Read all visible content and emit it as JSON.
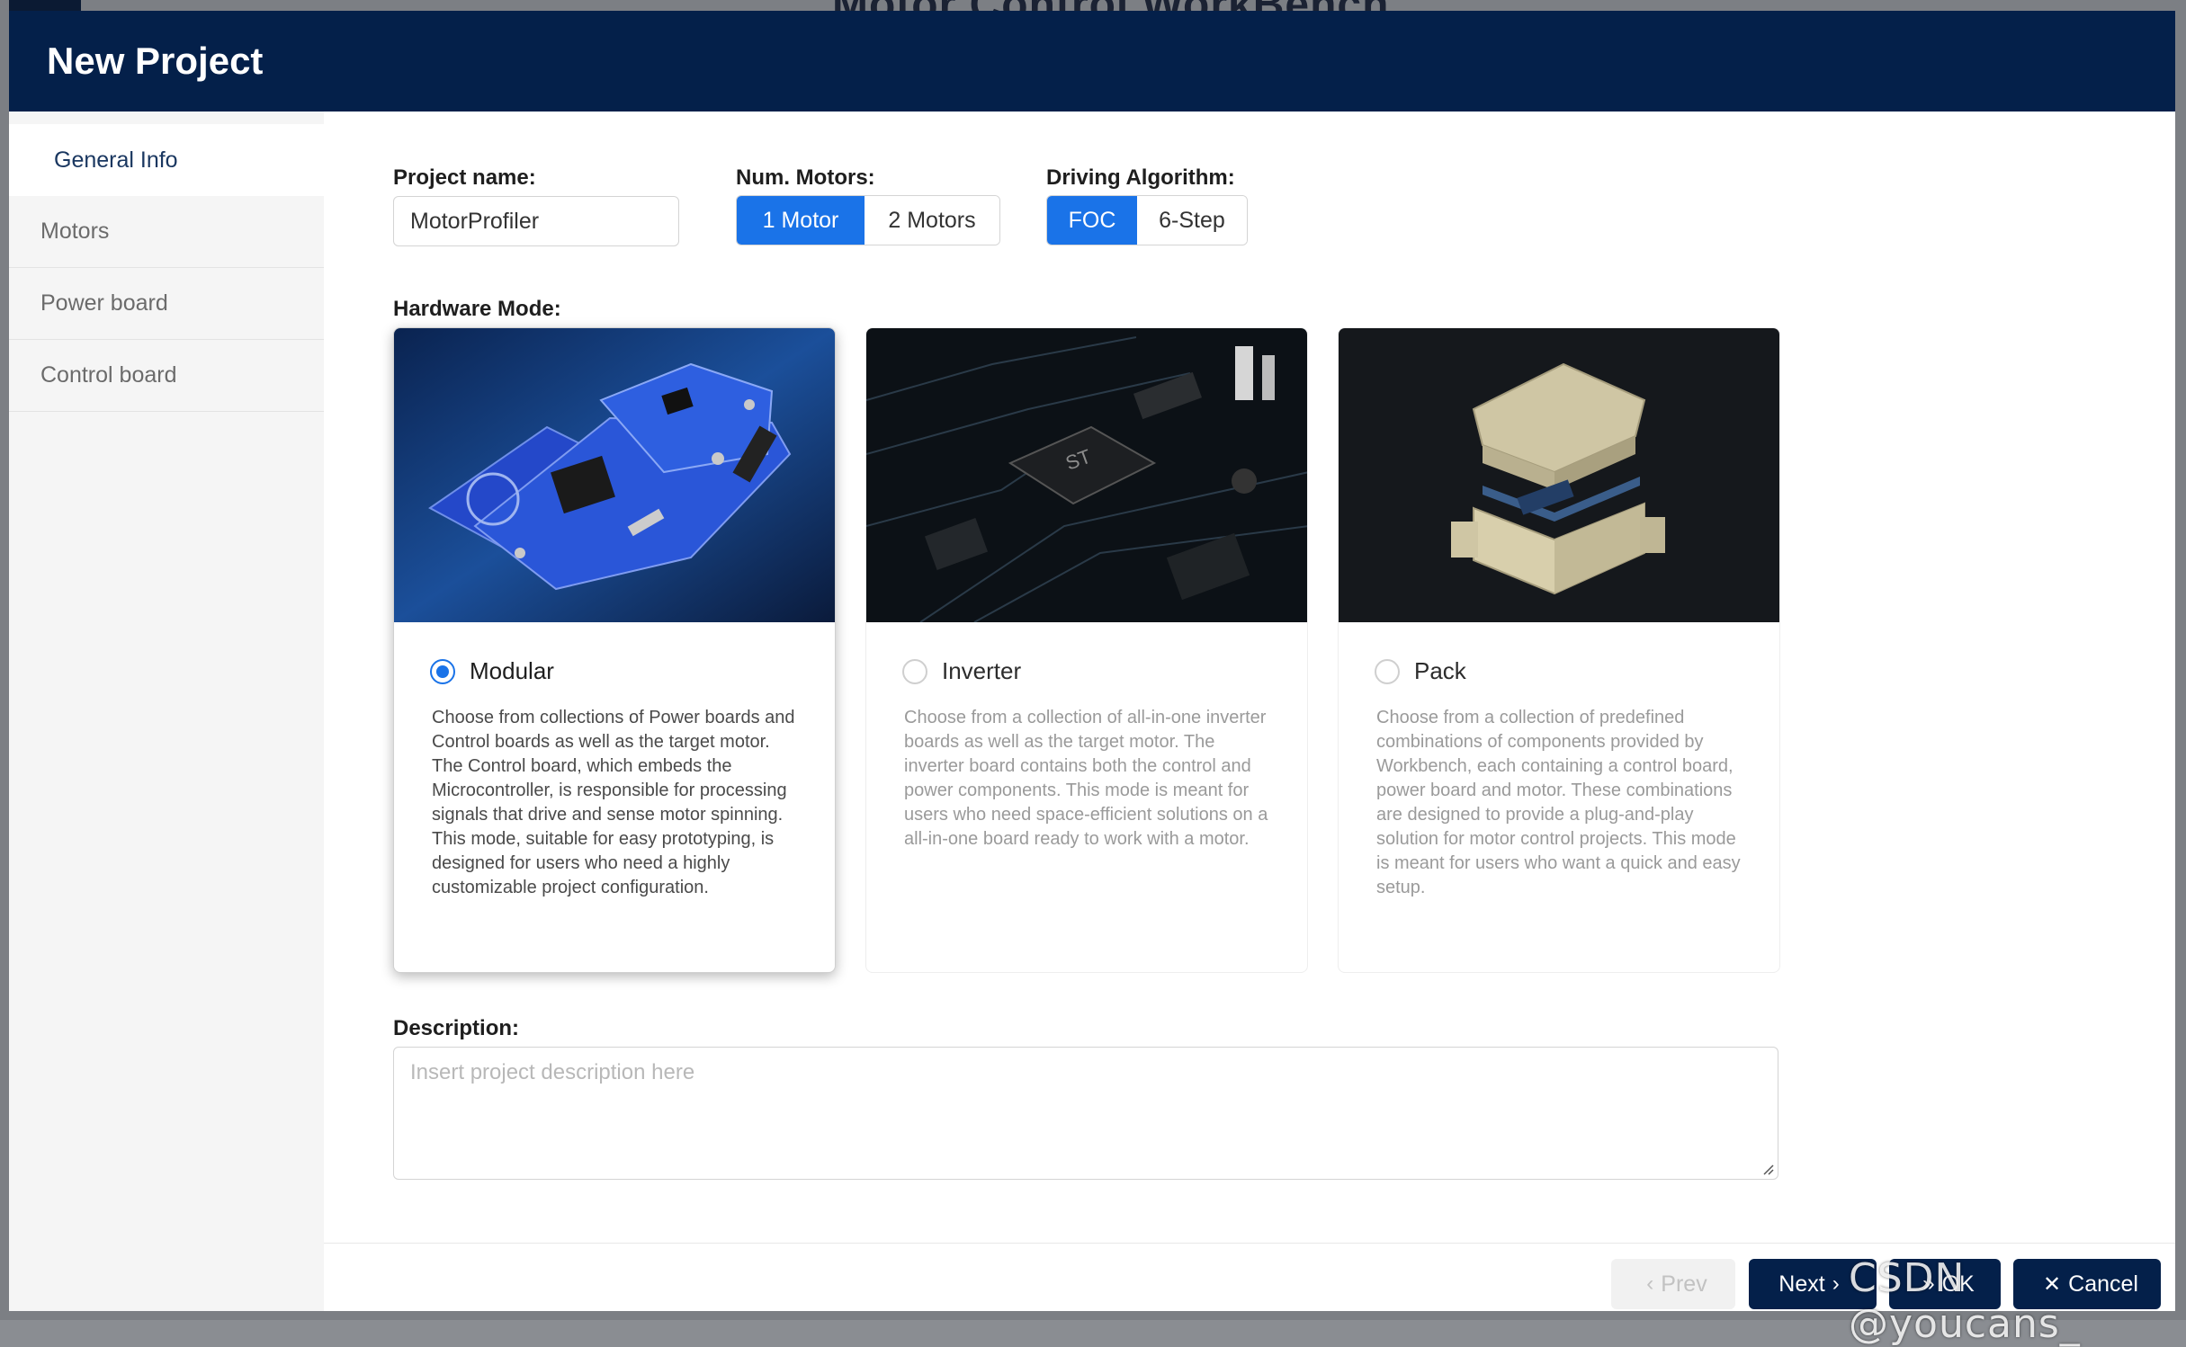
{
  "background_app": {
    "title": "Motor Control WorkBench"
  },
  "modal": {
    "title": "New Project"
  },
  "sidebar": {
    "items": [
      {
        "label": "General Info",
        "active": true
      },
      {
        "label": "Motors",
        "active": false
      },
      {
        "label": "Power board",
        "active": false
      },
      {
        "label": "Control board",
        "active": false
      }
    ]
  },
  "form": {
    "project_name": {
      "label": "Project name:",
      "value": "MotorProfiler"
    },
    "num_motors": {
      "label": "Num. Motors:",
      "options": [
        "1 Motor",
        "2 Motors"
      ],
      "selected": "1 Motor"
    },
    "driving_algorithm": {
      "label": "Driving Algorithm:",
      "options": [
        "FOC",
        "6-Step"
      ],
      "selected": "FOC"
    },
    "hardware_mode": {
      "label": "Hardware Mode:",
      "selected": "Modular",
      "cards": [
        {
          "name": "Modular",
          "desc": "Choose from collections of Power boards and Control boards as well as the target motor. The Control board, which embeds the Microcontroller, is responsible for processing signals that drive and sense motor spinning. This mode, suitable for easy prototyping, is designed for users who need a highly customizable project configuration."
        },
        {
          "name": "Inverter",
          "desc": "Choose from a collection of all-in-one inverter boards as well as the target motor. The inverter board contains both the control and power components. This mode is meant for users who need space-efficient solutions on a all-in-one board ready to work with a motor."
        },
        {
          "name": "Pack",
          "desc": "Choose from a collection of predefined combinations of components provided by Workbench, each containing a control board, power board and motor. These combinations are designed to provide a plug-and-play solution for motor control projects. This mode is meant for users who want a quick and easy setup."
        }
      ]
    },
    "description": {
      "label": "Description:",
      "placeholder": "Insert project description here",
      "value": ""
    }
  },
  "footer": {
    "prev_label": "Prev",
    "next_label": "Next",
    "ok_label": "OK",
    "cancel_label": "Cancel"
  },
  "watermark": "CSDN @youcans_",
  "colors": {
    "header": "#04204a",
    "accent": "#1a73e8",
    "footer_button": "#04204a"
  }
}
